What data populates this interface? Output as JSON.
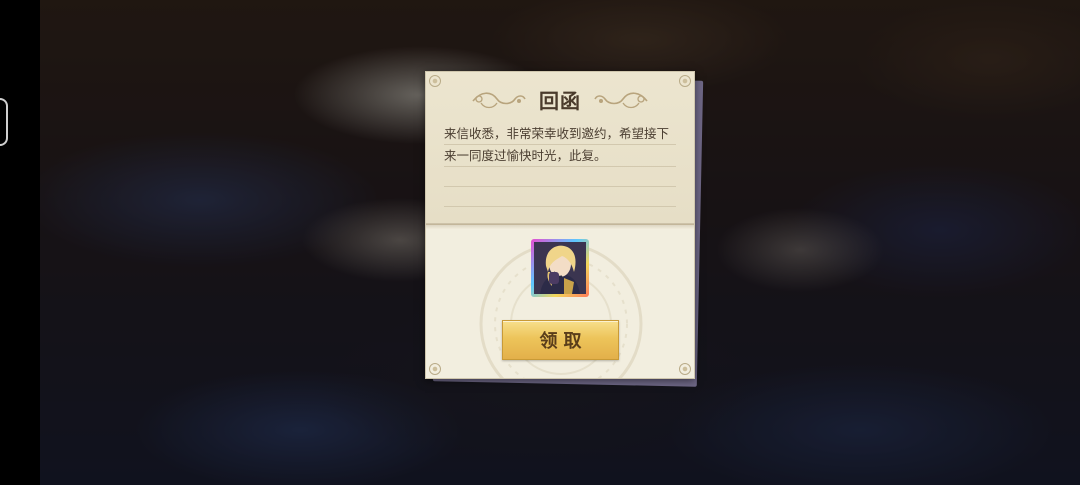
{
  "letter": {
    "title": "回函",
    "body": "来信收悉，非常荣幸收到邀约，希望接下来一同度过愉快时光，此复。"
  },
  "reward": {
    "icon": "character-portrait-blonde-icon",
    "frame_colors": [
      "#e84bd0",
      "#5bc7ff",
      "#f2d65a",
      "#ff7a5a"
    ]
  },
  "claim_button": {
    "label": "领取"
  },
  "colors": {
    "card_bg": "#f1ecdc",
    "button_gold": "#edc45a",
    "title_text": "#4a3b2c"
  }
}
